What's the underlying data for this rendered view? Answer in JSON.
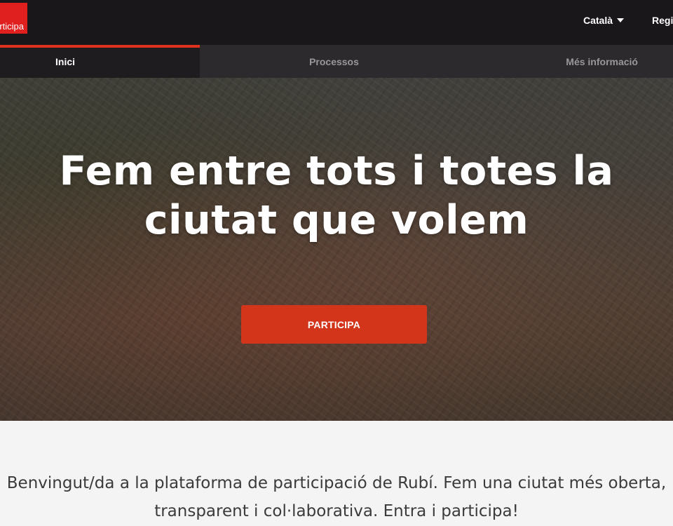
{
  "header": {
    "logo_text": "Participa",
    "language": "Català",
    "register_label": "Registre"
  },
  "nav": {
    "tabs": [
      {
        "label": "Inici",
        "active": true
      },
      {
        "label": "Processos",
        "active": false
      },
      {
        "label": "Més informació",
        "active": false
      }
    ]
  },
  "hero": {
    "title_line1": "Fem entre tots i totes la",
    "title_line2": "ciutat que volem",
    "cta_label": "PARTICIPA"
  },
  "intro": {
    "line1": "Benvingut/da a la plataforma de participació de Rubí. Fem una ciutat més oberta,",
    "line2": "transparent i col·laborativa. Entra i participa!"
  },
  "colors": {
    "accent": "#d3351a",
    "logo_red": "#e01f1f",
    "topbar": "#1a171b",
    "nav": "#2d2a2e"
  }
}
